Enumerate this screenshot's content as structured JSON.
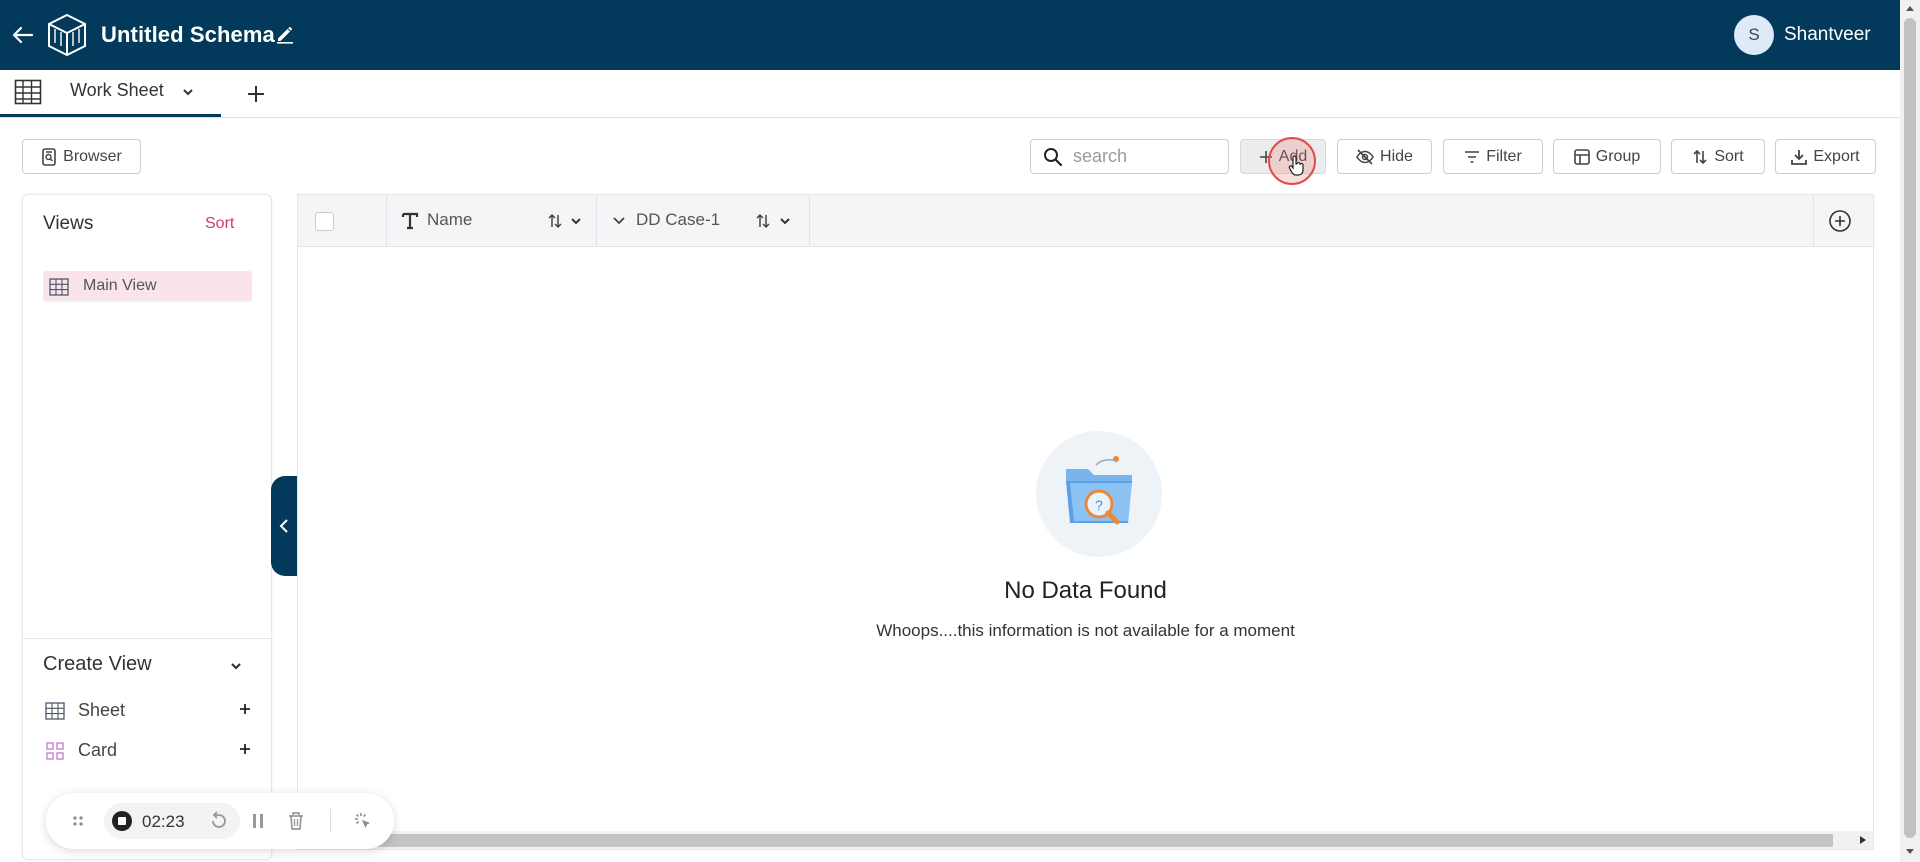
{
  "header": {
    "title": "Untitled Schema",
    "user_initial": "S",
    "user_name": "Shantveer",
    "bg_color": "#033a5b"
  },
  "tabs": [
    {
      "label": "Work Sheet",
      "active": true
    }
  ],
  "toolbar": {
    "browser_label": "Browser",
    "search_placeholder": "search",
    "search_value": "",
    "add_label": "Add",
    "hide_label": "Hide",
    "filter_label": "Filter",
    "group_label": "Group",
    "sort_label": "Sort",
    "export_label": "Export"
  },
  "sidebar": {
    "views_title": "Views",
    "views_sort": "Sort",
    "views": [
      {
        "label": "Main View",
        "icon": "grid-icon",
        "selected": true
      }
    ],
    "create_title": "Create View",
    "create_items": [
      {
        "label": "Sheet",
        "icon": "grid-icon"
      },
      {
        "label": "Card",
        "icon": "card-grid-icon"
      }
    ]
  },
  "grid": {
    "columns": [
      {
        "title": "Name",
        "type_icon": "text-type-icon"
      },
      {
        "title": "DD Case-1",
        "type_icon": "dropdown-type-icon"
      }
    ],
    "empty_title": "No Data Found",
    "empty_subtitle": "Whoops....this information is not available for a moment"
  },
  "recorder": {
    "time": "02:23"
  },
  "colors": {
    "accent_pink": "#d03a6b",
    "selected_view_bg": "#fbe3ea"
  }
}
